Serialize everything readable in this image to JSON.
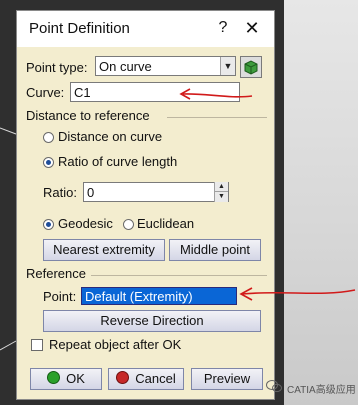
{
  "dialog": {
    "title": "Point Definition",
    "help_glyph": "?",
    "close_glyph": "✕"
  },
  "point_type": {
    "label": "Point type:",
    "value": "On curve"
  },
  "curve": {
    "label": "Curve:",
    "value": "C1"
  },
  "distance_section": {
    "title": "Distance to reference",
    "options": [
      {
        "label": "Distance on curve",
        "selected": false
      },
      {
        "label": "Ratio of curve length",
        "selected": true
      }
    ]
  },
  "ratio": {
    "label": "Ratio:",
    "value": "0"
  },
  "measure": {
    "options": [
      {
        "label": "Geodesic",
        "selected": true
      },
      {
        "label": "Euclidean",
        "selected": false
      }
    ]
  },
  "extremity_buttons": {
    "nearest": "Nearest extremity",
    "middle": "Middle point"
  },
  "reference": {
    "title": "Reference",
    "point_label": "Point:",
    "point_value": "Default (Extremity)",
    "reverse_button": "Reverse Direction"
  },
  "repeat": {
    "label": "Repeat object after OK",
    "checked": false
  },
  "footer": {
    "ok": "OK",
    "cancel": "Cancel",
    "preview": "Preview"
  },
  "watermark": {
    "text": "CATIA高级应用"
  },
  "colors": {
    "dialog_bg": "#f3edcf",
    "selection": "#0a66d6",
    "annotation_red": "#d11a1a",
    "ok_green": "#2aa02a",
    "cancel_red": "#c62828",
    "preview_blue": "#2d5fb5"
  }
}
